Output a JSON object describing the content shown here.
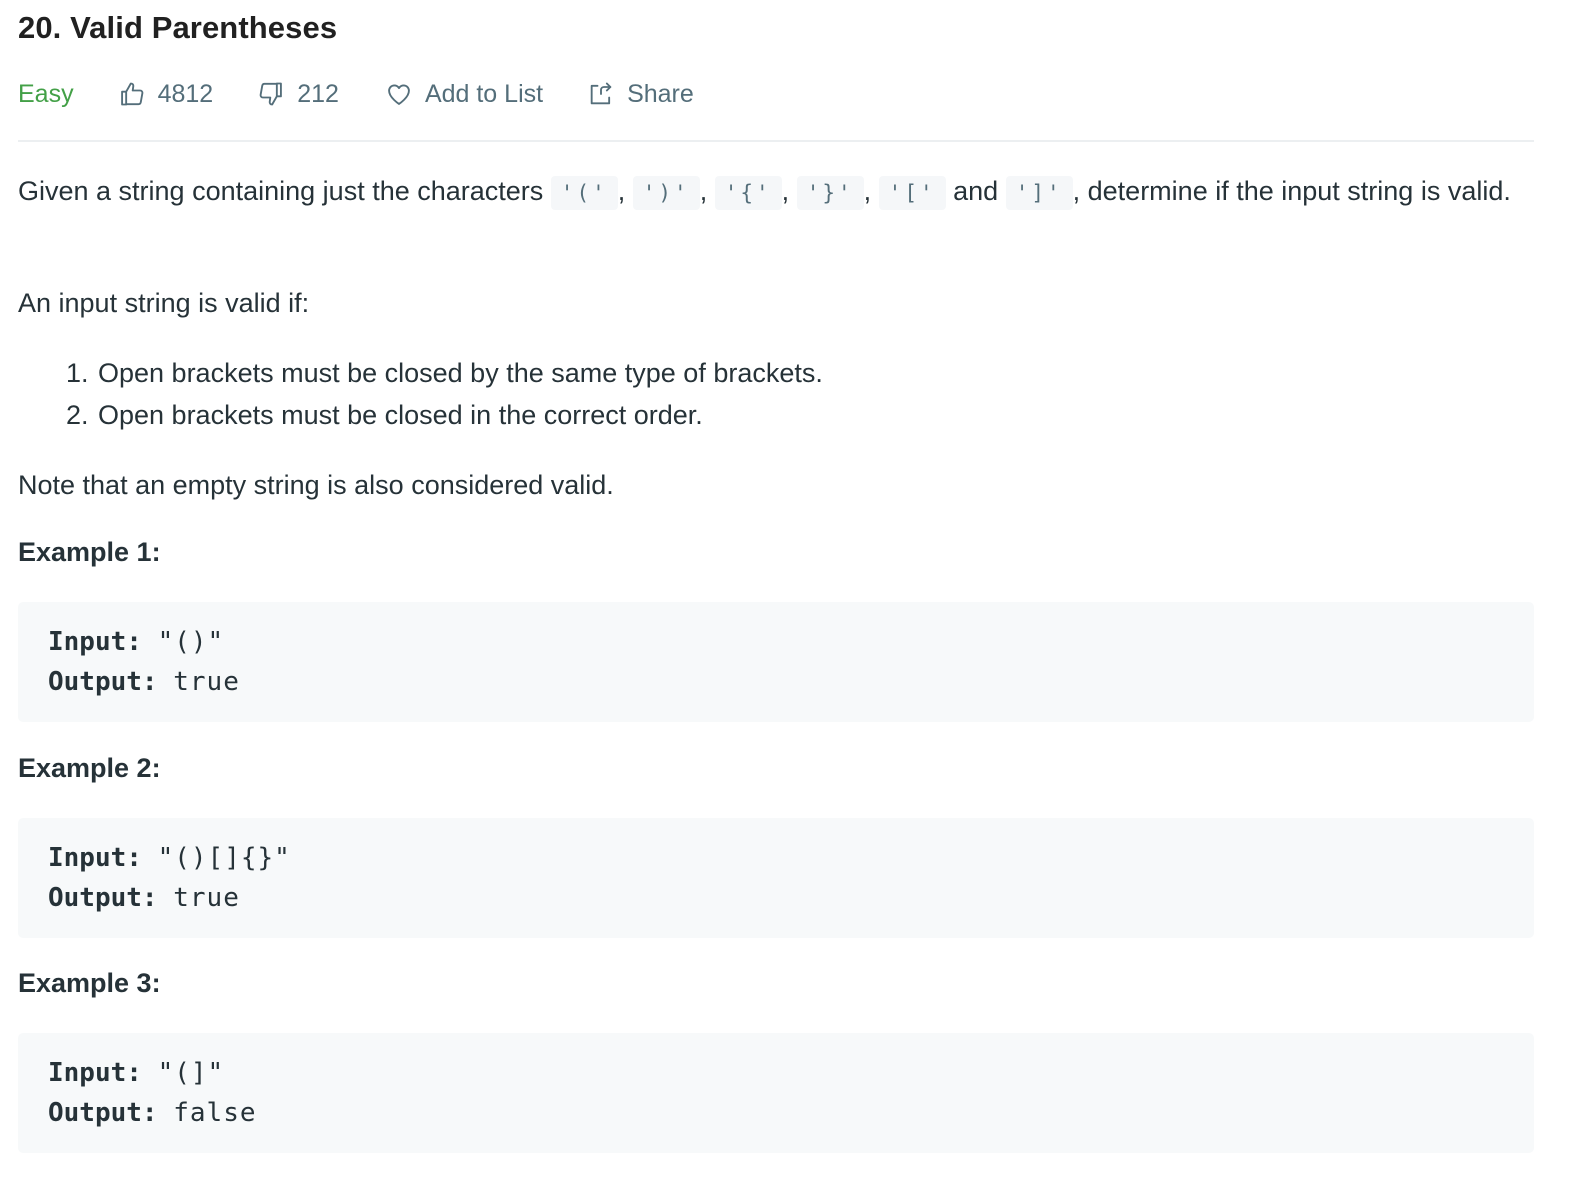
{
  "problem": {
    "title": "20. Valid Parentheses",
    "difficulty": "Easy",
    "likes": "4812",
    "dislikes": "212",
    "add_to_list": "Add to List",
    "share": "Share"
  },
  "description": {
    "intro_prefix": "Given a string containing just the characters",
    "chars": [
      "'('",
      "')'",
      "'{'",
      "'}'",
      "'['",
      "']'"
    ],
    "sep_comma": ",",
    "sep_and": "and",
    "intro_suffix": ", determine if the input string is valid.",
    "valid_if": "An input string is valid if:",
    "rules": [
      {
        "num": "1.",
        "text": "Open brackets must be closed by the same type of brackets."
      },
      {
        "num": "2.",
        "text": "Open brackets must be closed in the correct order."
      }
    ],
    "note": "Note that an empty string is also considered valid."
  },
  "examples": [
    {
      "title": "Example 1:",
      "input_label": "Input:",
      "input": "\"()\"",
      "output_label": "Output:",
      "output": "true"
    },
    {
      "title": "Example 2:",
      "input_label": "Input:",
      "input": "\"()[]{}\"",
      "output_label": "Output:",
      "output": "true"
    },
    {
      "title": "Example 3:",
      "input_label": "Input:",
      "input": "\"(]\"",
      "output_label": "Output:",
      "output": "false"
    }
  ],
  "colors": {
    "difficulty_easy": "#43a047",
    "meta_text": "#546e7a",
    "code_bg": "#f7f9fa"
  }
}
